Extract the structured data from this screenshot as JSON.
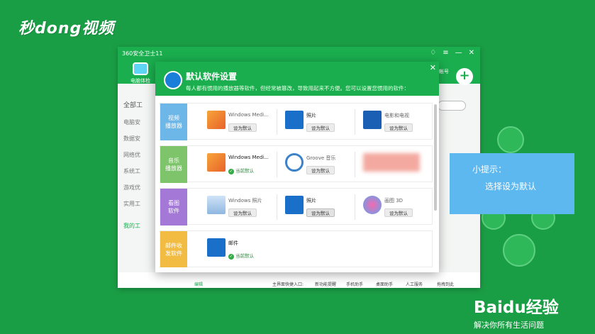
{
  "watermark": "秒dong视频",
  "window": {
    "title": "360安全卫士11",
    "tool_label": "电脑体检",
    "right_tool_label": "帐号",
    "sidebar": [
      "全部工",
      "电脑安",
      "数据安",
      "网络优",
      "系统工",
      "游戏优",
      "实用工",
      "我的工"
    ],
    "bottom": {
      "edit": "编辑",
      "quick": "主界面快捷入口:",
      "item1": "新功能提醒",
      "item2": "手机助手",
      "item3": "桌面助手",
      "item4": "人工服务",
      "item5": "拖拽到此"
    }
  },
  "dialog": {
    "title": "默认软件设置",
    "subtitle": "每人都有惯用的播放器等软件，但经常被篡改，导致用起来不方便。您可以设置您惯用的软件：",
    "set_default": "设为默认",
    "current_default": "当前默认",
    "rows": [
      {
        "category": "视频\n播放器",
        "color": "#6cb6e8",
        "apps": [
          {
            "name": "Windows Medi...",
            "state": "set",
            "icon": "media-player-icon"
          },
          {
            "name": "照片",
            "state": "set",
            "icon": "photos-icon"
          },
          {
            "name": "电影和电视",
            "state": "set",
            "icon": "movies-tv-icon"
          }
        ]
      },
      {
        "category": "音乐\n播放器",
        "color": "#7ec46a",
        "apps": [
          {
            "name": "Windows Medi...",
            "state": "current",
            "icon": "media-player-icon"
          },
          {
            "name": "Groove 音乐",
            "state": "set",
            "icon": "groove-icon"
          },
          {
            "name": "",
            "state": "blurred",
            "icon": "blurred-icon"
          }
        ]
      },
      {
        "category": "看图\n软件",
        "color": "#a478d6",
        "apps": [
          {
            "name": "Windows 照片",
            "state": "set",
            "icon": "windows-photo-icon"
          },
          {
            "name": "照片",
            "state": "hover",
            "icon": "photos-icon"
          },
          {
            "name": "画图 3D",
            "state": "set",
            "icon": "paint3d-icon"
          }
        ]
      },
      {
        "category": "邮件收\n发软件",
        "color": "#f2bc43",
        "apps": [
          {
            "name": "邮件",
            "state": "current",
            "icon": "mail-icon"
          }
        ]
      }
    ]
  },
  "tip": {
    "line1": "小提示：",
    "line2": "选择设为默认"
  },
  "brand": {
    "logo": "Baidu经验",
    "slogan": "解决你所有生活问题"
  },
  "colors": {
    "green": "#1aae4e",
    "tip": "#5eb8f0"
  }
}
